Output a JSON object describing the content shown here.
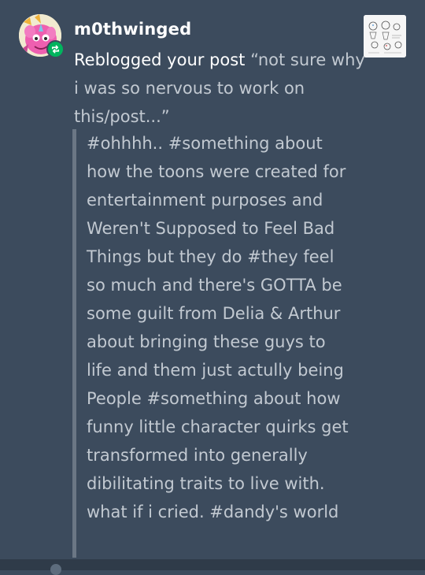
{
  "notification": {
    "username": "m0thwinged",
    "action": "Reblogged your post",
    "post_quote": "“not sure why i was so nervous to work on this/post...”",
    "tags": "#ohhhh.. #something about how the toons were created for entertainment purposes and Weren't Supposed to Feel Bad Things but they do #they feel so much and there's GOTTA be some guilt from Delia & Arthur about bringing these guys to life and them just actully being People #something about how funny little character quirks get transformed into generally dibilitating traits to live with. what if i cried. #dandy's world",
    "reblog_icon": "reblog-icon"
  },
  "colors": {
    "background": "#3c4b5d",
    "reblog_green": "#00b45e",
    "quote_text": "#c2c9d1",
    "quote_bar": "#6b7785"
  }
}
